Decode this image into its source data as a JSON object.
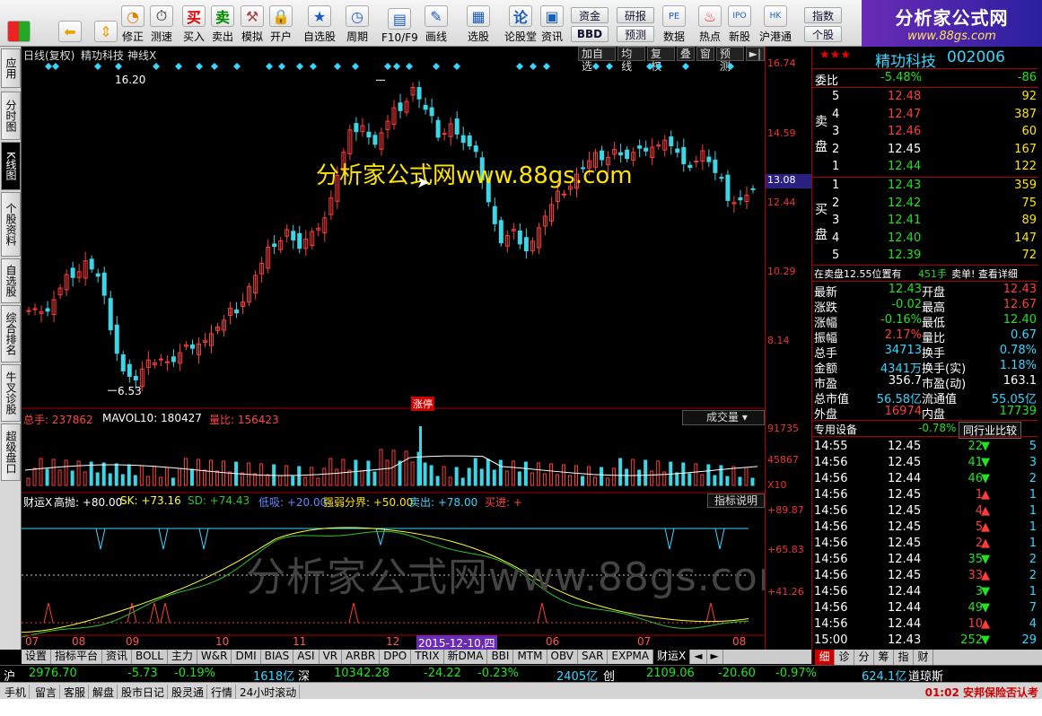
{
  "toolbar": {
    "items": [
      {
        "label": "",
        "icon": "grid-icon"
      },
      {
        "label": "",
        "icon": "back-arrow-icon"
      },
      {
        "label": "",
        "icon": "updown-arrow-icon"
      },
      {
        "label": "修正",
        "icon": "clock-icon"
      },
      {
        "label": "测速",
        "icon": "speed-icon"
      },
      {
        "label": "买入",
        "icon": "buy-icon"
      },
      {
        "label": "卖出",
        "icon": "sell-icon"
      },
      {
        "label": "模拟",
        "icon": "hammer-icon"
      },
      {
        "label": "开户",
        "icon": "lock-icon"
      },
      {
        "label": "自选股",
        "icon": "star-icon"
      },
      {
        "label": "周期",
        "icon": "period-icon"
      },
      {
        "label": "F10/F9",
        "icon": "f10-icon"
      },
      {
        "label": "画线",
        "icon": "pencil-icon"
      },
      {
        "label": "选股",
        "icon": "select-icon"
      },
      {
        "label": "论股堂",
        "icon": "forum-icon"
      },
      {
        "label": "资讯",
        "icon": "news-icon"
      },
      {
        "label": "数据",
        "icon": "pe-icon"
      },
      {
        "label": "热点",
        "icon": "fire-icon"
      },
      {
        "label": "新股",
        "icon": "ipo-icon"
      },
      {
        "label": "沪港通",
        "icon": "hk-icon"
      }
    ],
    "small_buttons": [
      "资金",
      "研报",
      "BBD",
      "预测",
      "指数",
      "个股"
    ],
    "buy_char": "买",
    "sell_char": "卖"
  },
  "logo": {
    "title": "分析家公式网",
    "url": "www.88gs.com"
  },
  "left_tabs": [
    "应用",
    "分时图",
    "K线图",
    "个股资料",
    "自选股",
    "综合排名",
    "牛叉诊股",
    "超级盘口"
  ],
  "chart": {
    "header": {
      "period": "日线(复权)",
      "stock": "精功科技",
      "indicator": "神线X"
    },
    "buttons": [
      "加自选",
      "均线",
      "复权",
      "叠",
      "窗",
      "预测"
    ],
    "high_label": "16.20",
    "low_label": "6.53",
    "price_axis": [
      "16.74",
      "14.59",
      "12.44",
      "10.29",
      "8.14"
    ],
    "current_price": "13.08",
    "watermark": "分析家公式网www.88gs.com",
    "watermark2": "分析家公式网www.88gs.com",
    "limit_label": "涨停",
    "vol_header": {
      "total": "总手: 237862",
      "mavol": "MAVOL10: 180427",
      "ratio": "量比: 156423"
    },
    "vol_select": "成交量",
    "vol_axis": [
      "91735",
      "45867",
      "X10"
    ],
    "ind_header": {
      "name": "财运X",
      "gaopao": "高抛: +80.00",
      "sk": "SK: +73.16",
      "sd": "SD: +74.43",
      "dixi": "低吸: +20.00",
      "qiangruo": "强弱分界: +50.00",
      "maichu": "卖出: +78.00",
      "maijin": "买进: +"
    },
    "ind_button": "指标说明",
    "ind_axis": [
      "+89.87",
      "+65.83",
      "+41.26"
    ],
    "x_labels": [
      "07",
      "08",
      "09",
      "10",
      "11",
      "12",
      "2015-12-10,四",
      "06",
      "07",
      "08"
    ]
  },
  "chart_data": {
    "type": "candlestick",
    "title": "精功科技 日线(复权)",
    "ylim": [
      6.0,
      17.0
    ],
    "high": 16.2,
    "low": 6.53,
    "approx_close_series": [
      9.2,
      9.0,
      9.6,
      10.2,
      10.6,
      10.0,
      8.6,
      7.2,
      6.8,
      7.3,
      7.6,
      7.4,
      7.8,
      8.1,
      8.3,
      8.6,
      9.1,
      9.8,
      10.4,
      11.2,
      11.6,
      10.9,
      11.3,
      12.0,
      13.2,
      14.5,
      14.9,
      14.2,
      14.8,
      15.4,
      16.0,
      15.2,
      14.6,
      14.9,
      14.2,
      13.8,
      12.5,
      11.1,
      11.4,
      11.0,
      11.6,
      12.2,
      12.8,
      13.3,
      13.6,
      13.9,
      14.1,
      13.7,
      13.9,
      14.2,
      14.3,
      13.8,
      13.6,
      14.0,
      13.2,
      12.6,
      12.5,
      12.7
    ]
  },
  "quote": {
    "stars": "★★★",
    "name": "精功科技",
    "code": "002006",
    "weibi": {
      "label": "委比",
      "pct": "-5.48%",
      "val": "-86"
    },
    "sell": [
      {
        "n": "5",
        "p": "12.48",
        "v": "92"
      },
      {
        "n": "4",
        "p": "12.47",
        "v": "387"
      },
      {
        "n": "3",
        "p": "12.46",
        "v": "60"
      },
      {
        "n": "2",
        "p": "12.45",
        "v": "167"
      },
      {
        "n": "1",
        "p": "12.44",
        "v": "122"
      }
    ],
    "buy": [
      {
        "n": "1",
        "p": "12.43",
        "v": "359"
      },
      {
        "n": "2",
        "p": "12.42",
        "v": "75"
      },
      {
        "n": "3",
        "p": "12.41",
        "v": "89"
      },
      {
        "n": "4",
        "p": "12.40",
        "v": "147"
      },
      {
        "n": "5",
        "p": "12.39",
        "v": "72"
      }
    ],
    "sell_side": "卖盘",
    "buy_side": "买盘",
    "info_line": "在卖盘12.55位置有",
    "info_vol": "451手",
    "info_tail": "卖单! 查看详细",
    "stats": [
      {
        "l1": "最新",
        "v1": "12.43",
        "l2": "开盘",
        "v2": "12.43"
      },
      {
        "l1": "涨跌",
        "v1": "-0.02",
        "l2": "最高",
        "v2": "12.67"
      },
      {
        "l1": "涨幅",
        "v1": "-0.16%",
        "l2": "最低",
        "v2": "12.40"
      },
      {
        "l1": "振幅",
        "v1": "2.17%",
        "l2": "量比",
        "v2": "0.67"
      },
      {
        "l1": "总手",
        "v1": "34713",
        "l2": "换手",
        "v2": "0.78%"
      },
      {
        "l1": "金额",
        "v1": "4341万",
        "l2": "换手(实)",
        "v2": "1.18%"
      },
      {
        "l1": "市盈",
        "v1": "356.7",
        "l2": "市盈(动)",
        "v2": "163.1"
      },
      {
        "l1": "总市值",
        "v1": "56.58亿",
        "l2": "流通值",
        "v2": "55.05亿"
      },
      {
        "l1": "外盘",
        "v1": "16974",
        "l2": "内盘",
        "v2": "17739"
      }
    ],
    "sector": {
      "name": "专用设备",
      "pct": "-0.78%",
      "btn": "同行业比较"
    },
    "ticks": [
      {
        "t": "14:55",
        "p": "12.45",
        "v": "22",
        "d": "down",
        "c": "5"
      },
      {
        "t": "14:56",
        "p": "12.45",
        "v": "41",
        "d": "down",
        "c": "3"
      },
      {
        "t": "14:56",
        "p": "12.44",
        "v": "46",
        "d": "down",
        "c": "2"
      },
      {
        "t": "14:56",
        "p": "12.45",
        "v": "1",
        "d": "up",
        "c": "1"
      },
      {
        "t": "14:56",
        "p": "12.45",
        "v": "4",
        "d": "up",
        "c": "1"
      },
      {
        "t": "14:56",
        "p": "12.45",
        "v": "5",
        "d": "up",
        "c": "1"
      },
      {
        "t": "14:56",
        "p": "12.45",
        "v": "2",
        "d": "up",
        "c": "1"
      },
      {
        "t": "14:56",
        "p": "12.44",
        "v": "35",
        "d": "down",
        "c": "2"
      },
      {
        "t": "14:56",
        "p": "12.45",
        "v": "33",
        "d": "up",
        "c": "2"
      },
      {
        "t": "14:56",
        "p": "12.44",
        "v": "3",
        "d": "down",
        "c": "1"
      },
      {
        "t": "14:56",
        "p": "12.44",
        "v": "49",
        "d": "down",
        "c": "7"
      },
      {
        "t": "14:56",
        "p": "12.44",
        "v": "10",
        "d": "up",
        "c": "4"
      },
      {
        "t": "15:00",
        "p": "12.43",
        "v": "252",
        "d": "down",
        "c": "29"
      }
    ]
  },
  "bottom_tabs": [
    "设置",
    "指标平台",
    "资讯",
    "BOLL",
    "主力",
    "W&R",
    "DMI",
    "BIAS",
    "ASI",
    "VR",
    "ARBR",
    "DPO",
    "TRIX",
    "新DMA",
    "BBI",
    "MTM",
    "OBV",
    "SAR",
    "EXPMA",
    "财运X"
  ],
  "right_tabs": [
    "细",
    "诊",
    "分",
    "筹",
    "指",
    "财"
  ],
  "indices": [
    {
      "name": "沪",
      "val": "2976.70",
      "chg": "-5.73",
      "pct": "-0.19%",
      "amt": "1618亿"
    },
    {
      "name": "深",
      "val": "10342.28",
      "chg": "-24.22",
      "pct": "-0.23%",
      "amt": "2405亿"
    },
    {
      "name": "创",
      "val": "2109.06",
      "chg": "-20.60",
      "pct": "-0.97%",
      "amt": "624.1亿"
    }
  ],
  "index_tail": "道琼斯",
  "status": [
    "手机",
    "留言",
    "客服",
    "解盘",
    "股市日记",
    "股灵通",
    "行情",
    "24小时滚动"
  ],
  "status_right": "01:02 安邦保险否认考"
}
